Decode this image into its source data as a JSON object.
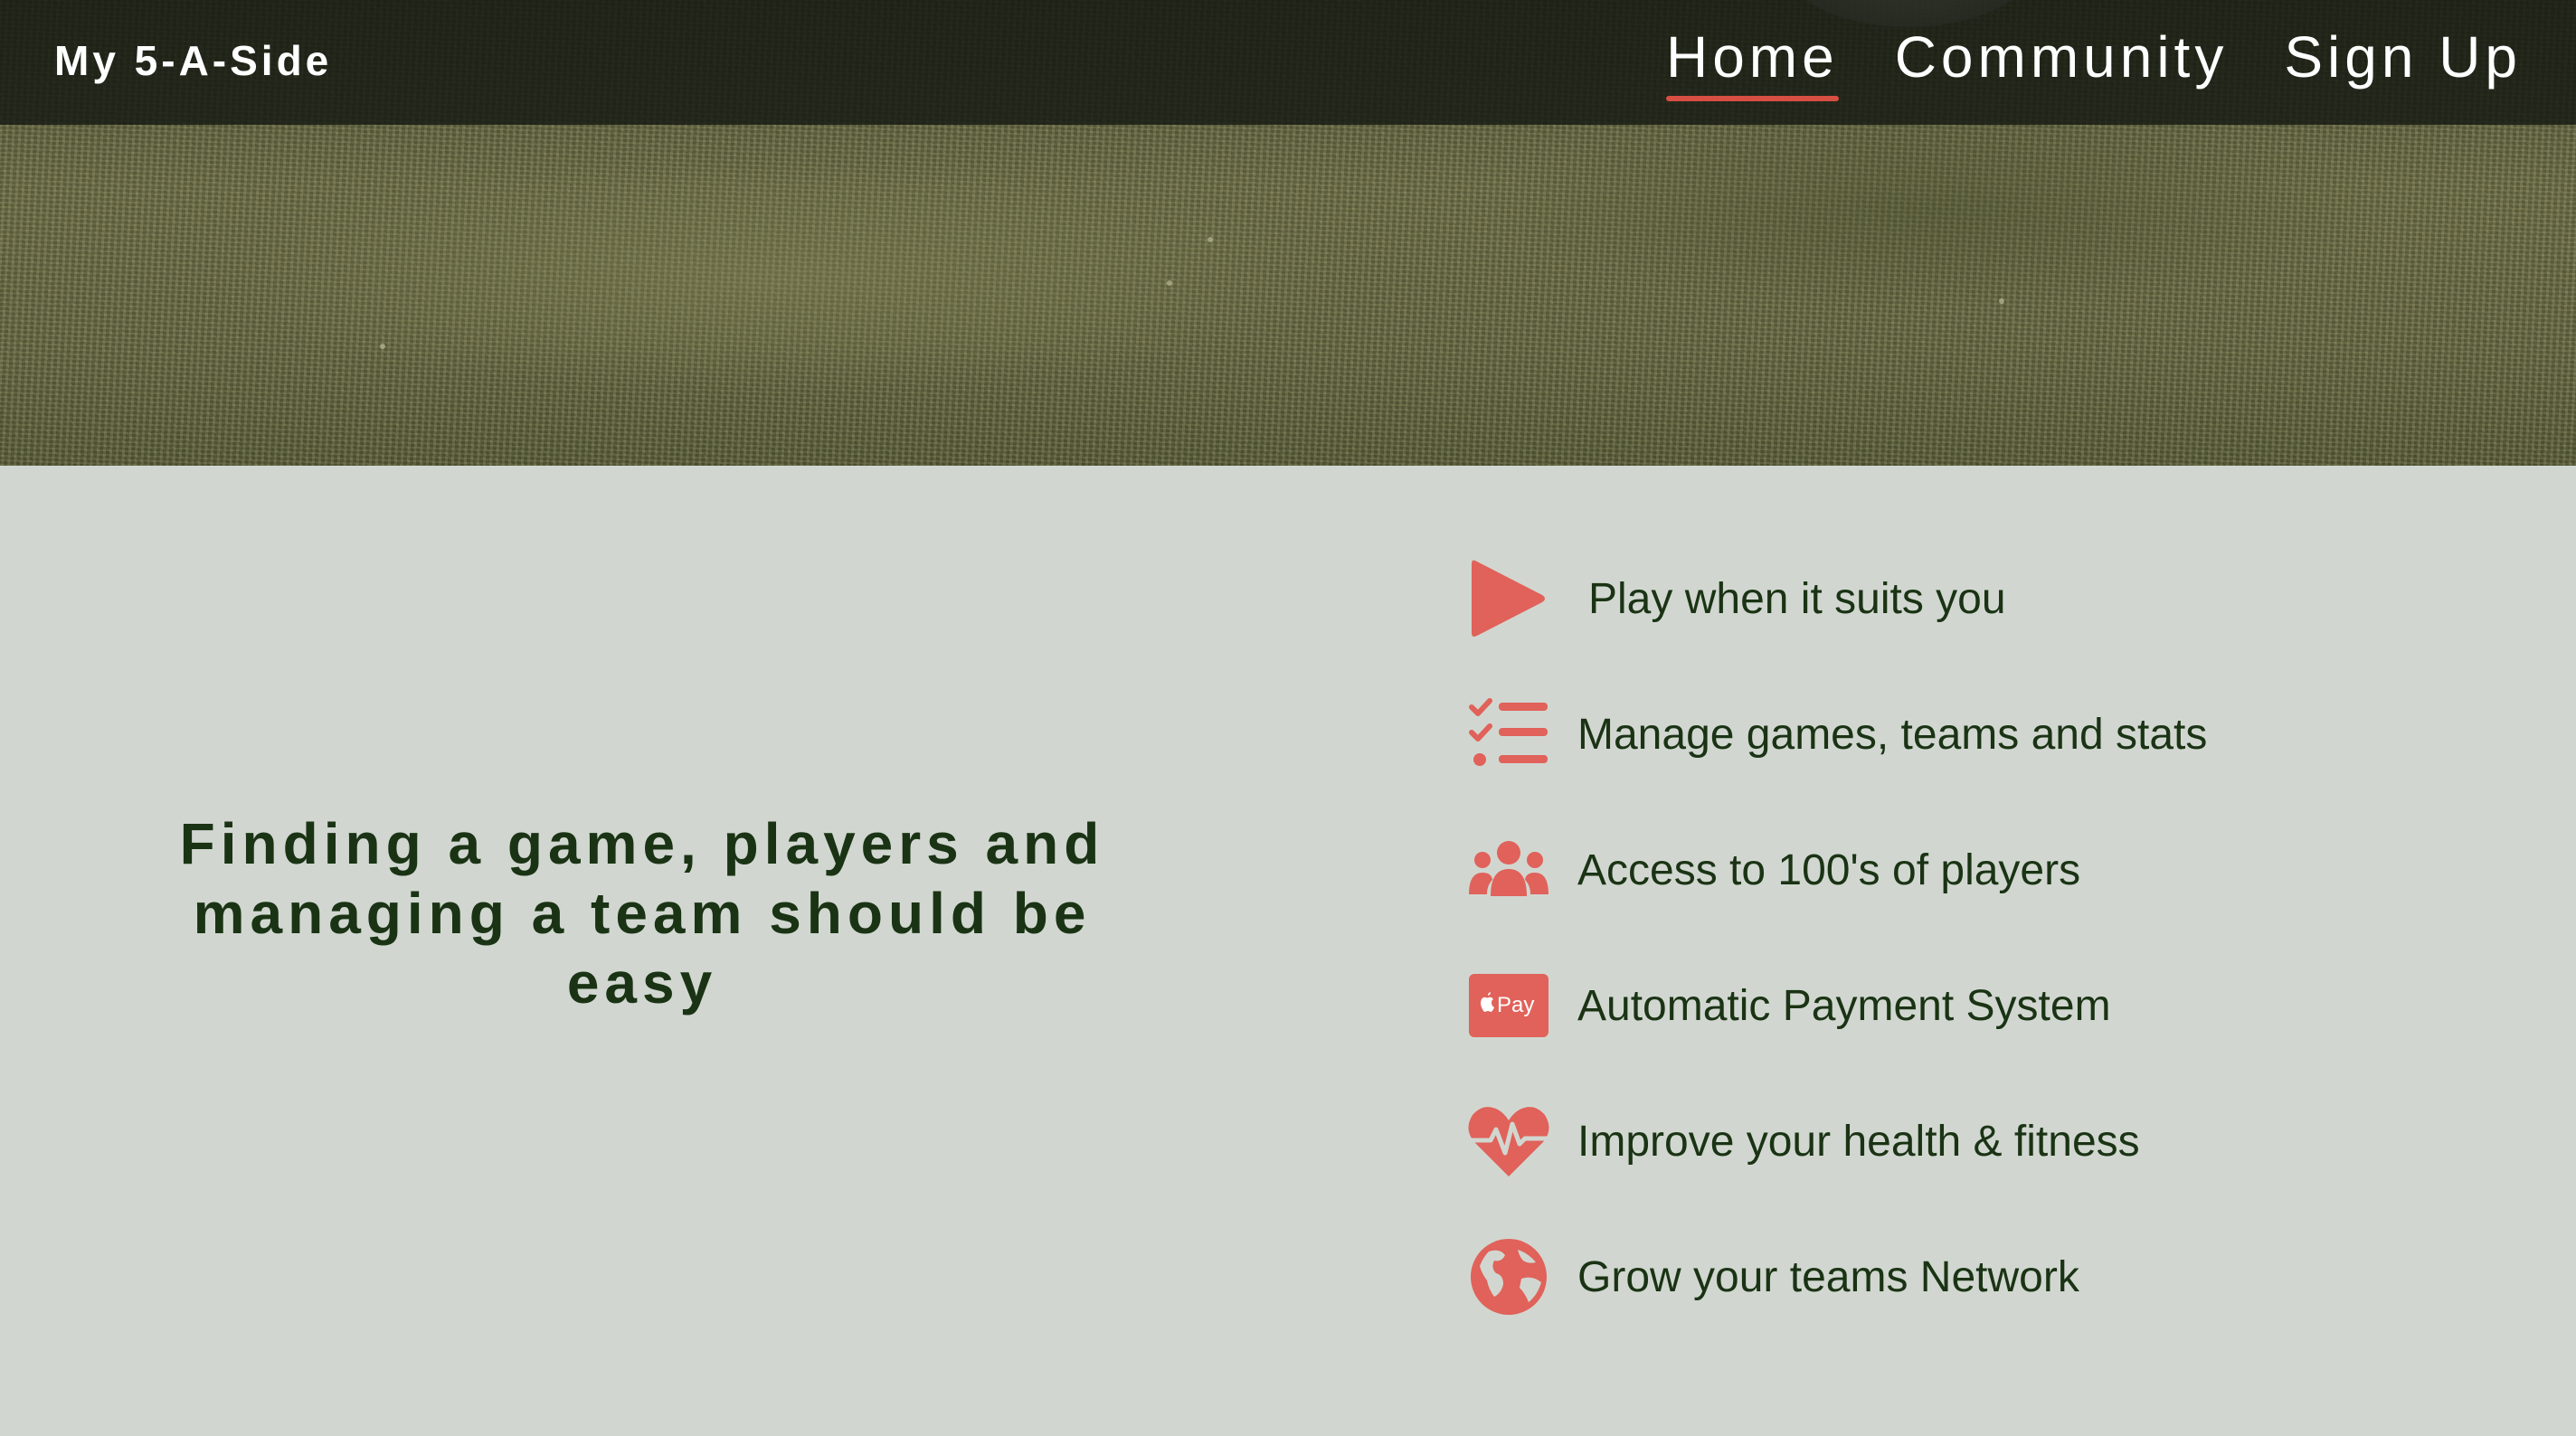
{
  "brand": {
    "title": "My 5-A-Side"
  },
  "nav": {
    "items": [
      {
        "label": "Home",
        "active": true
      },
      {
        "label": "Community",
        "active": false
      },
      {
        "label": "Sign Up",
        "active": false
      }
    ]
  },
  "main": {
    "tagline": "Finding a game, players and managing a team should be easy"
  },
  "features": [
    {
      "icon": "play-icon",
      "label": "Play when it suits you"
    },
    {
      "icon": "checklist-icon",
      "label": "Manage games, teams and stats"
    },
    {
      "icon": "users-icon",
      "label": "Access to 100's of players"
    },
    {
      "icon": "apple-pay-icon",
      "label": "Automatic Payment System",
      "icon_text": "Pay"
    },
    {
      "icon": "heartbeat-icon",
      "label": "Improve your health & fitness"
    },
    {
      "icon": "globe-icon",
      "label": "Grow your teams Network"
    }
  ],
  "colors": {
    "accent": "#e0625a",
    "text_dark_green": "#1a3314",
    "background": "#d1d7d0",
    "navbar": "#1a1e14"
  }
}
